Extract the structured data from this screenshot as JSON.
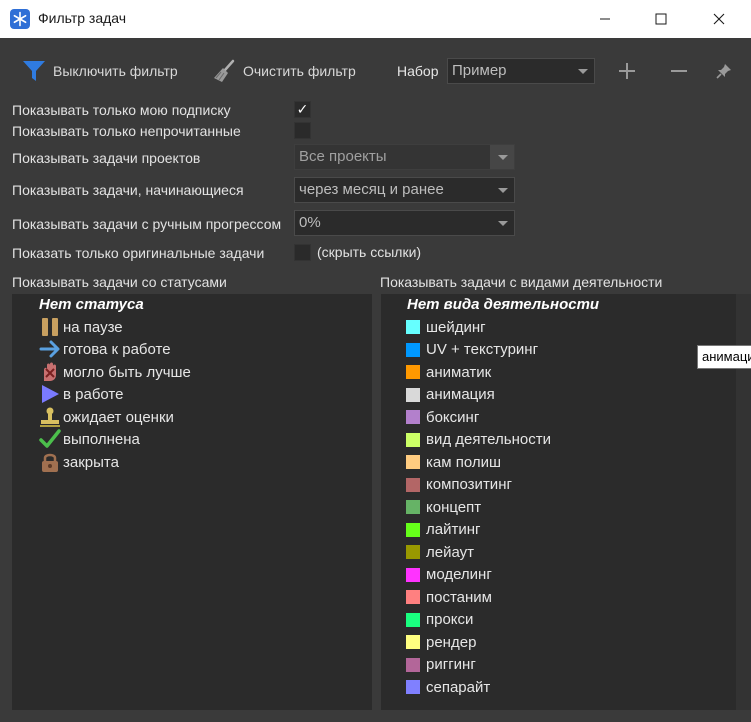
{
  "window": {
    "title": "Фильтр задач",
    "icons": {
      "app": "snowflake-app-icon",
      "minimize": "minimize-icon",
      "maximize": "maximize-icon",
      "close": "close-icon"
    }
  },
  "toolbar": {
    "disable_filter_label": "Выключить фильтр",
    "clear_filter_label": "Очистить фильтр",
    "preset_label": "Набор",
    "preset_value": "Пример",
    "icons": {
      "filter": "funnel-icon",
      "broom": "broom-icon",
      "add": "plus-icon",
      "remove": "minus-icon",
      "pin": "pin-icon"
    }
  },
  "options": {
    "only_my_subscription": {
      "label": "Показывать только мою подписку",
      "checked": true,
      "mark": "✓"
    },
    "only_unread": {
      "label": "Показывать только непрочитанные",
      "checked": false
    },
    "project_tasks": {
      "label": "Показывать задачи проектов",
      "value": "Все проекты"
    },
    "starting_tasks": {
      "label": "Показывать задачи, начинающиеся",
      "value": "через месяц и ранее"
    },
    "manual_progress": {
      "label": "Показывать задачи с ручным прогрессом",
      "value": "0%"
    },
    "only_original": {
      "label": "Показать только оригинальные задачи",
      "checked": false,
      "hide_links_label": "(скрыть ссылки)"
    }
  },
  "statuses": {
    "label": "Показывать задачи со статусами",
    "header": "Нет статуса",
    "items": [
      {
        "label": "на паузе",
        "icon": "pause-icon",
        "color": "#c8a060"
      },
      {
        "label": "готова к работе",
        "icon": "arrow-right-icon",
        "color": "#5aa0e0"
      },
      {
        "label": "могло быть лучше",
        "icon": "hand-stop-icon",
        "color": "#c87070"
      },
      {
        "label": "в работе",
        "icon": "play-icon",
        "color": "#7a7aff"
      },
      {
        "label": "ожидает оценки",
        "icon": "stamp-icon",
        "color": "#d8c060"
      },
      {
        "label": "выполнена",
        "icon": "checkmark-icon",
        "color": "#4cbf4c"
      },
      {
        "label": "закрыта",
        "icon": "lock-icon",
        "color": "#a07050"
      }
    ]
  },
  "activities": {
    "label": "Показывать задачи с видами деятельности",
    "header": "Нет вида деятельности",
    "items": [
      {
        "label": "шейдинг",
        "color": "#66ffff"
      },
      {
        "label": "UV + текстуринг",
        "color": "#0099ff"
      },
      {
        "label": "аниматик",
        "color": "#ff9900"
      },
      {
        "label": "анимация",
        "color": "#d9d9d9"
      },
      {
        "label": "боксинг",
        "color": "#b380cc"
      },
      {
        "label": "вид деятельности",
        "color": "#ccff66"
      },
      {
        "label": "кам полиш",
        "color": "#ffcc80"
      },
      {
        "label": "композитинг",
        "color": "#b36666"
      },
      {
        "label": "концепт",
        "color": "#66b366"
      },
      {
        "label": "лайтинг",
        "color": "#66ff1a"
      },
      {
        "label": "лейаут",
        "color": "#999900"
      },
      {
        "label": "моделинг",
        "color": "#ff33ff"
      },
      {
        "label": "постаним",
        "color": "#ff8080"
      },
      {
        "label": "прокси",
        "color": "#1aff80"
      },
      {
        "label": "рендер",
        "color": "#ffff80"
      },
      {
        "label": "риггинг",
        "color": "#b36699"
      },
      {
        "label": "сепарайт",
        "color": "#8080ff"
      }
    ]
  },
  "tooltip": {
    "text": "анимация"
  }
}
